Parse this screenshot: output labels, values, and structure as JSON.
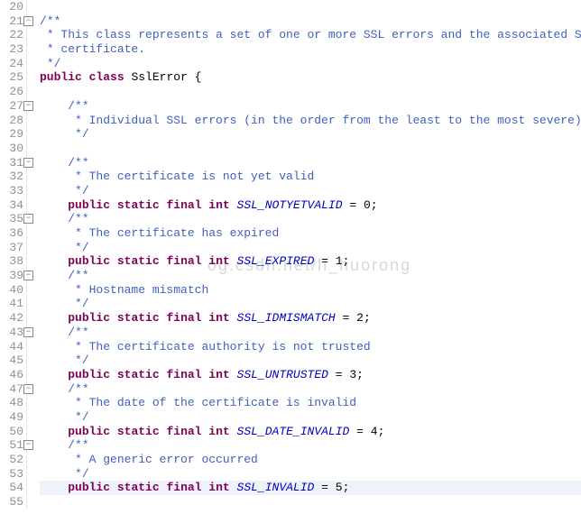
{
  "watermark": "og.csdn.net/li_huorong",
  "gutter": {
    "start": 20,
    "end": 55,
    "foldable": [
      21,
      27,
      31,
      35,
      39,
      43,
      47,
      51
    ]
  },
  "code": {
    "l20": {
      "indent": ""
    },
    "l21": {
      "indent": "",
      "jd": "/**"
    },
    "l22": {
      "indent": " ",
      "jd": "* This class represents a set of one or more SSL errors and the associated SSL"
    },
    "l23": {
      "indent": " ",
      "jd": "* certificate."
    },
    "l24": {
      "indent": " ",
      "jd": "*/"
    },
    "l25": {
      "indent": "",
      "kw1": "public",
      "kw2": "class",
      "name": "SslError",
      "tail": " {"
    },
    "l26": {
      "indent": ""
    },
    "l27": {
      "indent": "    ",
      "jd": "/**"
    },
    "l28": {
      "indent": "     ",
      "jd": "* Individual SSL errors (in the order from the least to the most severe):"
    },
    "l29": {
      "indent": "     ",
      "jd": "*/"
    },
    "l30": {
      "indent": ""
    },
    "l31": {
      "indent": "    ",
      "jd": "/**"
    },
    "l32": {
      "indent": "     ",
      "jd": "* The certificate is not yet valid"
    },
    "l33": {
      "indent": "     ",
      "jd": "*/"
    },
    "l34": {
      "indent": "    ",
      "kw1": "public",
      "kw2": "static",
      "kw3": "final",
      "kw4": "int",
      "cid": "SSL_NOTYETVALID",
      "val": "0"
    },
    "l35": {
      "indent": "    ",
      "jd": "/**"
    },
    "l36": {
      "indent": "     ",
      "jd": "* The certificate has expired"
    },
    "l37": {
      "indent": "     ",
      "jd": "*/"
    },
    "l38": {
      "indent": "    ",
      "kw1": "public",
      "kw2": "static",
      "kw3": "final",
      "kw4": "int",
      "cid": "SSL_EXPIRED",
      "val": "1"
    },
    "l39": {
      "indent": "    ",
      "jd": "/**"
    },
    "l40": {
      "indent": "     ",
      "jd": "* Hostname mismatch"
    },
    "l41": {
      "indent": "     ",
      "jd": "*/"
    },
    "l42": {
      "indent": "    ",
      "kw1": "public",
      "kw2": "static",
      "kw3": "final",
      "kw4": "int",
      "cid": "SSL_IDMISMATCH",
      "val": "2"
    },
    "l43": {
      "indent": "    ",
      "jd": "/**"
    },
    "l44": {
      "indent": "     ",
      "jd": "* The certificate authority is not trusted"
    },
    "l45": {
      "indent": "     ",
      "jd": "*/"
    },
    "l46": {
      "indent": "    ",
      "kw1": "public",
      "kw2": "static",
      "kw3": "final",
      "kw4": "int",
      "cid": "SSL_UNTRUSTED",
      "val": "3"
    },
    "l47": {
      "indent": "    ",
      "jd": "/**"
    },
    "l48": {
      "indent": "     ",
      "jd": "* The date of the certificate is invalid"
    },
    "l49": {
      "indent": "     ",
      "jd": "*/"
    },
    "l50": {
      "indent": "    ",
      "kw1": "public",
      "kw2": "static",
      "kw3": "final",
      "kw4": "int",
      "cid": "SSL_DATE_INVALID",
      "val": "4"
    },
    "l51": {
      "indent": "    ",
      "jd": "/**"
    },
    "l52": {
      "indent": "     ",
      "jd": "* A generic error occurred"
    },
    "l53": {
      "indent": "     ",
      "jd": "*/"
    },
    "l54": {
      "indent": "    ",
      "kw1": "public",
      "kw2": "static",
      "kw3": "final",
      "kw4": "int",
      "cid": "SSL_INVALID",
      "val": "5"
    },
    "l55": {
      "indent": ""
    }
  }
}
